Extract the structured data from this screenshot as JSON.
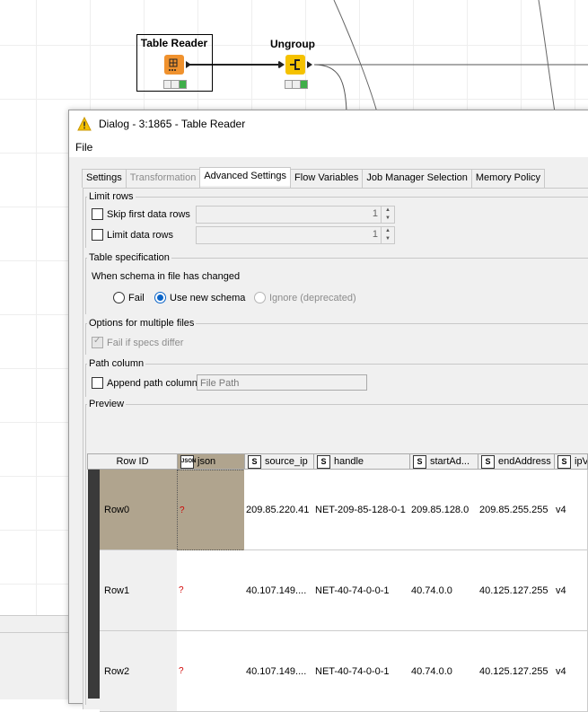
{
  "workflow": {
    "nodes": [
      {
        "title": "Table Reader",
        "color": "#f0922e"
      },
      {
        "title": "Ungroup",
        "color": "#f5c200"
      }
    ]
  },
  "dialog": {
    "title": "Dialog - 3:1865 - Table Reader",
    "menu": [
      "File"
    ],
    "tabs": [
      "Settings",
      "Transformation",
      "Advanced Settings",
      "Flow Variables",
      "Job Manager Selection",
      "Memory Policy"
    ],
    "active_tab": "Advanced Settings",
    "limit_rows": {
      "legend": "Limit rows",
      "skip_label": "Skip first data rows",
      "skip_value": "1",
      "limit_label": "Limit data rows",
      "limit_value": "1"
    },
    "table_spec": {
      "legend": "Table specification",
      "prompt": "When schema in file has changed",
      "options": [
        "Fail",
        "Use new schema",
        "Ignore (deprecated)"
      ],
      "selected": "Use new schema"
    },
    "multiple_files": {
      "legend": "Options for multiple files",
      "fail_label": "Fail if specs differ"
    },
    "path_column": {
      "legend": "Path column",
      "append_label": "Append path column",
      "field_value": "File Path"
    },
    "preview": {
      "legend": "Preview",
      "columns": [
        {
          "name": "Row ID",
          "type": ""
        },
        {
          "name": "json",
          "type": "JSON"
        },
        {
          "name": "source_ip",
          "type": "S"
        },
        {
          "name": "handle",
          "type": "S"
        },
        {
          "name": "startAd...",
          "type": "S"
        },
        {
          "name": "endAddress",
          "type": "S"
        },
        {
          "name": "ipV",
          "type": "S"
        }
      ],
      "rows": [
        [
          "Row0",
          "?",
          "209.85.220.41",
          "NET-209-85-128-0-1",
          "209.85.128.0",
          "209.85.255.255",
          "v4"
        ],
        [
          "Row1",
          "?",
          "40.107.149....",
          "NET-40-74-0-0-1",
          "40.74.0.0",
          "40.125.127.255",
          "v4"
        ],
        [
          "Row2",
          "?",
          "40.107.149....",
          "NET-40-74-0-0-1",
          "40.74.0.0",
          "40.125.127.255",
          "v4"
        ]
      ]
    }
  }
}
